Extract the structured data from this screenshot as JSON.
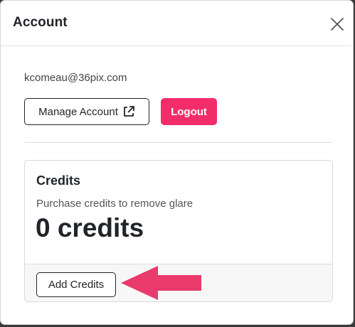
{
  "modal": {
    "title": "Account",
    "close_icon": "close-icon"
  },
  "account": {
    "email": "kcomeau@36pix.com",
    "manage_label": "Manage Account",
    "manage_icon": "external-link-icon",
    "logout_label": "Logout"
  },
  "credits": {
    "title": "Credits",
    "description": "Purchase credits to remove glare",
    "value": "0 credits",
    "add_label": "Add Credits"
  },
  "colors": {
    "accent": "#f22d6a",
    "text": "#212529"
  },
  "annotation": {
    "icon": "arrow-left-icon"
  }
}
